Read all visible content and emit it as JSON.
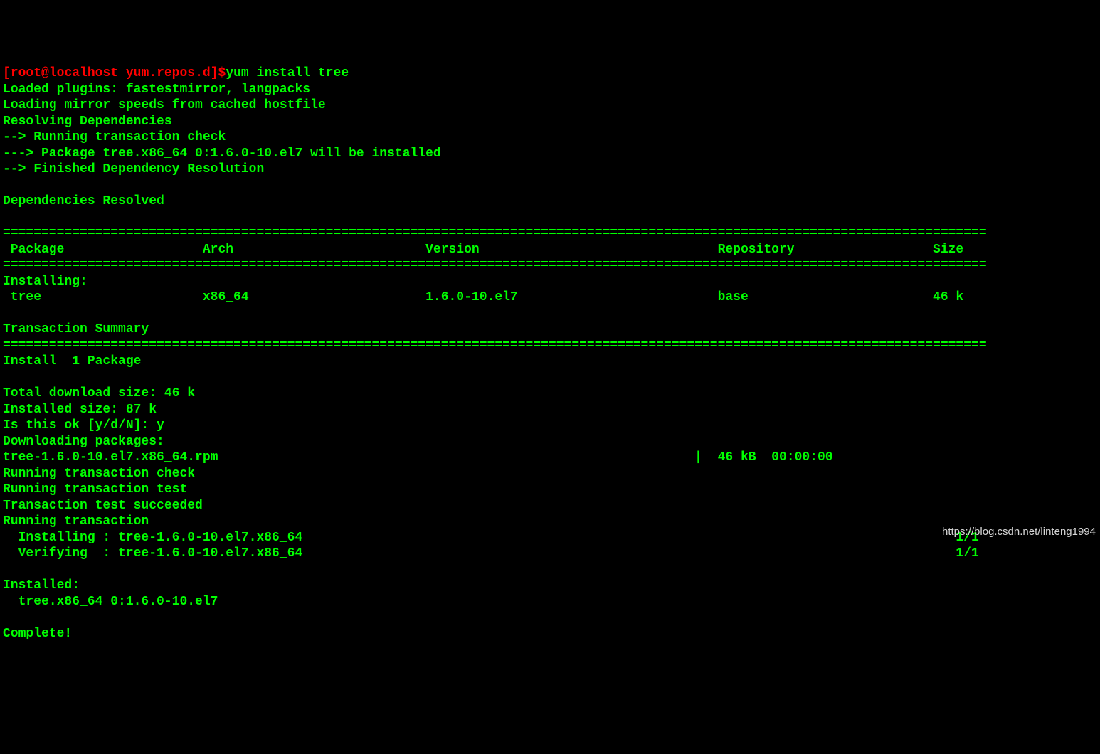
{
  "prompt": {
    "open_bracket": "[",
    "user": "root",
    "at": "@",
    "host": "localhost",
    "space": " ",
    "path": "yum.repos.d",
    "close_bracket": "]",
    "dollar": "$"
  },
  "command": "yum install tree",
  "lines": {
    "l1": "Loaded plugins: fastestmirror, langpacks",
    "l2": "Loading mirror speeds from cached hostfile",
    "l3": "Resolving Dependencies",
    "l4": "--> Running transaction check",
    "l5": "---> Package tree.x86_64 0:1.6.0-10.el7 will be installed",
    "l6": "--> Finished Dependency Resolution",
    "l7_blank": "",
    "l8": "Dependencies Resolved",
    "l9_blank": "",
    "rule1": "================================================================================================================================",
    "header": " Package                  Arch                         Version                               Repository                  Size",
    "rule2": "================================================================================================================================",
    "installing_hdr": "Installing:",
    "row1": " tree                     x86_64                       1.6.0-10.el7                          base                        46 k",
    "l_blank2": "",
    "tx_summary": "Transaction Summary",
    "rule3": "================================================================================================================================",
    "install_count": "Install  1 Package",
    "l_blank3": "",
    "dl_size": "Total download size: 46 k",
    "inst_size": "Installed size: 87 k",
    "confirm": "Is this ok [y/d/N]: y",
    "dl_pkgs": "Downloading packages:",
    "dl_line": "tree-1.6.0-10.el7.x86_64.rpm                                                              |  46 kB  00:00:00",
    "rtc": "Running transaction check",
    "rtt": "Running transaction test",
    "tts": "Transaction test succeeded",
    "rt": "Running transaction",
    "inst_step": "  Installing : tree-1.6.0-10.el7.x86_64                                                                                     1/1",
    "ver_step": "  Verifying  : tree-1.6.0-10.el7.x86_64                                                                                     1/1",
    "l_blank4": "",
    "installed_hdr": "Installed:",
    "installed_pkg": "  tree.x86_64 0:1.6.0-10.el7",
    "l_blank5": "",
    "complete": "Complete!"
  },
  "watermark": "https://blog.csdn.net/linteng1994"
}
